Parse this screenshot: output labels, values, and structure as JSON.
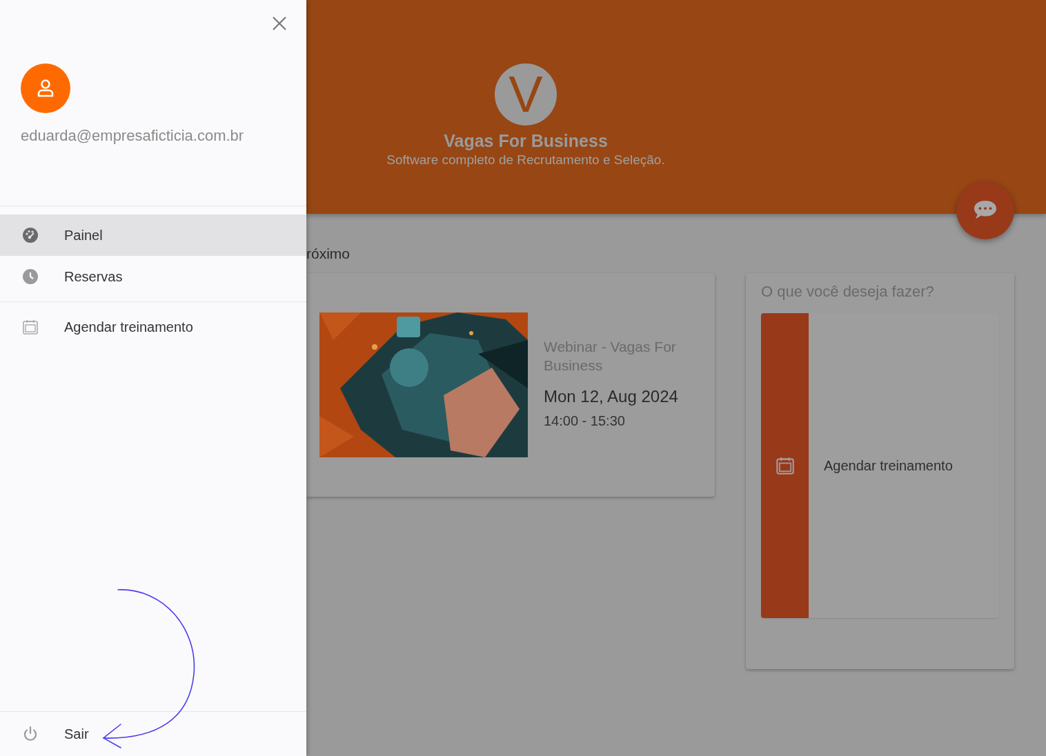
{
  "drawer": {
    "user_email": "eduarda@empresaficticia.com.br",
    "main_menu": [
      {
        "label": "Painel",
        "kind": "dashboard",
        "selected": true
      },
      {
        "label": "Reservas",
        "kind": "clock",
        "selected": false
      }
    ],
    "extra_menu": [
      {
        "label": "Agendar treinamento",
        "kind": "calendar",
        "selected": false
      }
    ],
    "logout": "Sair"
  },
  "header": {
    "logo_letter": "V",
    "title": "Vagas For Business",
    "subtitle": "Software completo de Recrutamento e Seleção."
  },
  "section_heading": "róximo",
  "event_card": {
    "title": "Webinar - Vagas For Business",
    "date": "Mon 12, Aug 2024",
    "time": "14:00 - 15:30"
  },
  "actions_card": {
    "title": "O que você deseja fazer?",
    "actions": [
      {
        "label": "Agendar treinamento",
        "kind": "calendar"
      }
    ]
  }
}
